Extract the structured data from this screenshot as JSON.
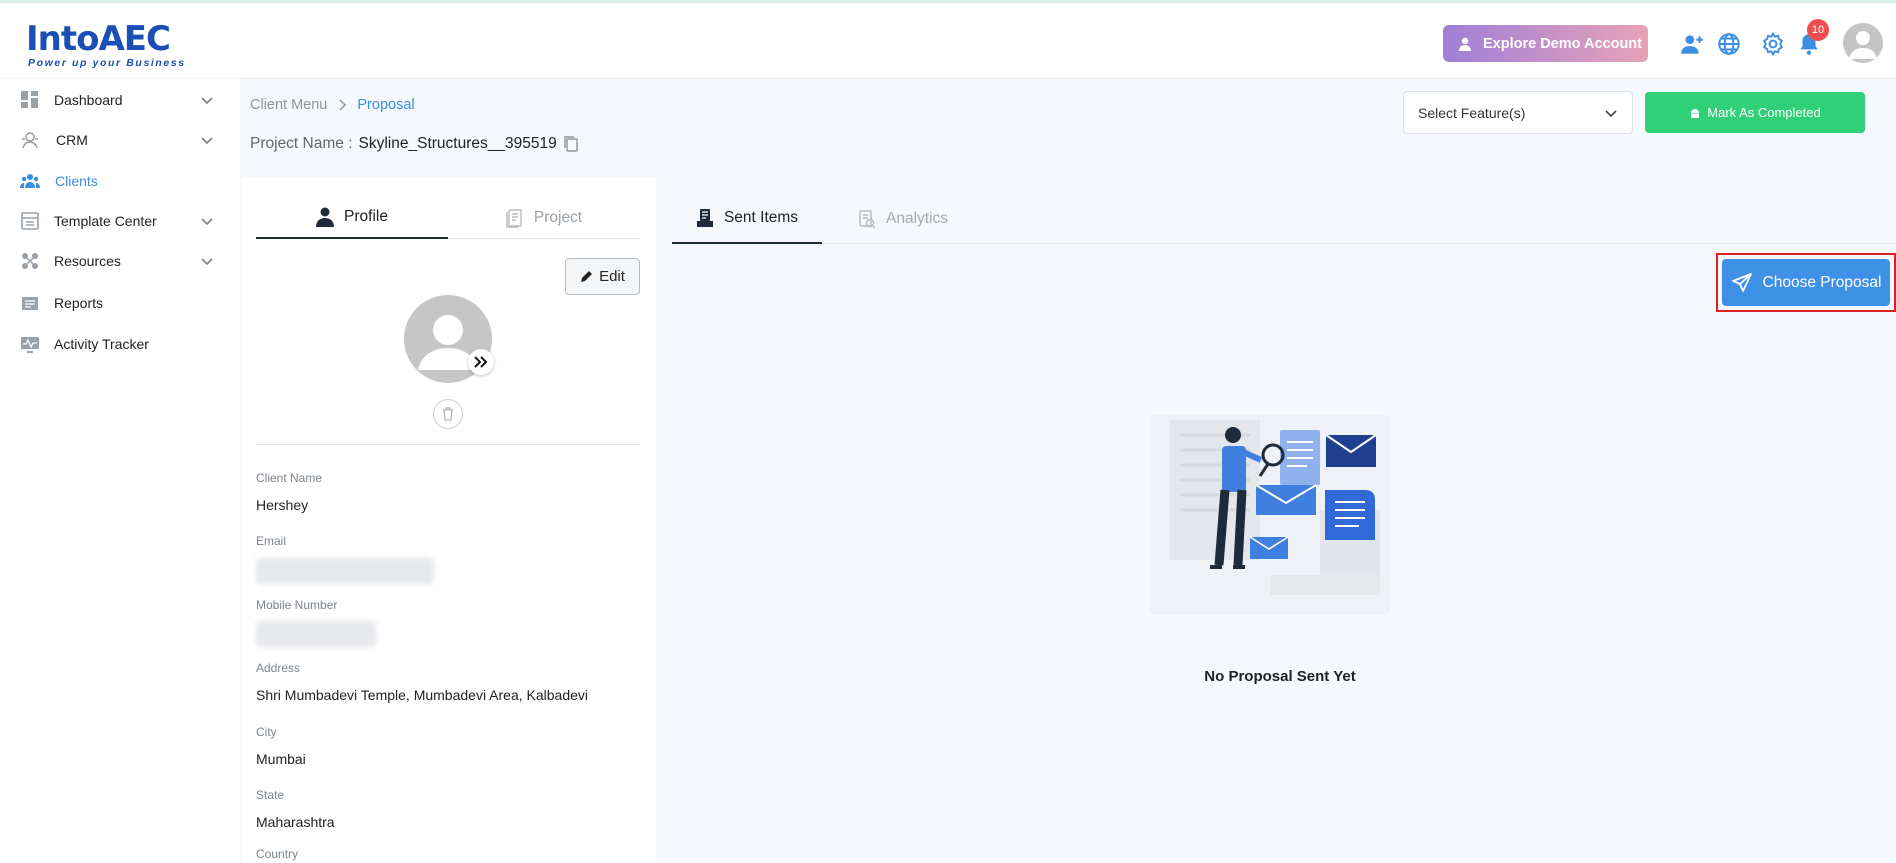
{
  "brand": {
    "name": "IntoAEC",
    "tagline": "Power up your Business",
    "primary_color": "#1a4fb5",
    "accent_color": "#3b8fe0"
  },
  "topbar": {
    "explore_label": "Explore Demo Account",
    "notification_count": "10",
    "icons": [
      "add-user-icon",
      "globe-icon",
      "gear-icon",
      "bell-icon",
      "user-avatar-icon"
    ]
  },
  "sidebar": {
    "items": [
      {
        "label": "Dashboard",
        "icon": "dashboard-icon",
        "has_children": true
      },
      {
        "label": "CRM",
        "icon": "crm-icon",
        "has_children": true
      },
      {
        "label": "Clients",
        "icon": "clients-icon",
        "has_children": false,
        "active": true
      },
      {
        "label": "Template Center",
        "icon": "template-icon",
        "has_children": true
      },
      {
        "label": "Resources",
        "icon": "resources-icon",
        "has_children": true
      },
      {
        "label": "Reports",
        "icon": "reports-icon",
        "has_children": false
      },
      {
        "label": "Activity Tracker",
        "icon": "activity-icon",
        "has_children": false
      }
    ]
  },
  "breadcrumb": {
    "parent": "Client Menu",
    "current": "Proposal"
  },
  "project": {
    "label": "Project Name :",
    "value": "Skyline_Structures__395519"
  },
  "header_actions": {
    "select_feature_placeholder": "Select Feature(s)",
    "mark_completed_label": "Mark As Completed",
    "mark_color": "#2fd077"
  },
  "profile_panel": {
    "tabs": [
      {
        "label": "Profile",
        "active": true
      },
      {
        "label": "Project",
        "active": false
      }
    ],
    "edit_label": "Edit",
    "fields": [
      {
        "label": "Client Name",
        "value": "Hershey"
      },
      {
        "label": "Email",
        "value": ""
      },
      {
        "label": "Mobile Number",
        "value": ""
      },
      {
        "label": "Address",
        "value": "Shri Mumbadevi Temple, Mumbadevi Area, Kalbadevi"
      },
      {
        "label": "City",
        "value": "Mumbai"
      },
      {
        "label": "State",
        "value": "Maharashtra"
      },
      {
        "label": "Country",
        "value": ""
      }
    ]
  },
  "main": {
    "tabs": [
      {
        "label": "Sent Items",
        "active": true
      },
      {
        "label": "Analytics",
        "active": false
      }
    ],
    "choose_proposal_label": "Choose Proposal",
    "empty_message": "No Proposal Sent Yet"
  }
}
